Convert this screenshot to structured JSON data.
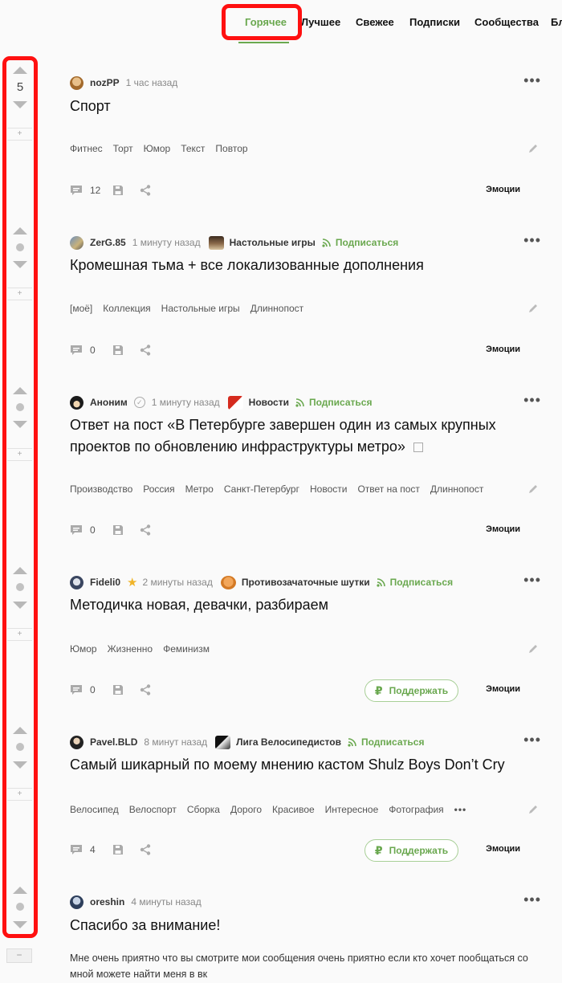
{
  "nav": {
    "tabs": [
      {
        "label": "Горячее",
        "active": true
      },
      {
        "label": "Лучшее",
        "active": false
      },
      {
        "label": "Свежее",
        "active": false
      },
      {
        "label": "Подписки",
        "active": false
      },
      {
        "label": "Сообщества",
        "active": false
      },
      {
        "label": "Бл",
        "active": false
      }
    ]
  },
  "colors": {
    "accent": "#6aa84f",
    "highlight": "#ff1010"
  },
  "rating": {
    "first_score": "5",
    "separator_glyph": "+",
    "collapse_glyph": "−"
  },
  "stories": [
    {
      "author": "nozPP",
      "time": "1 час назад",
      "title": "Спорт",
      "tags": [
        "Фитнес",
        "Торт",
        "Юмор",
        "Текст",
        "Повтор"
      ],
      "comments": "12",
      "emotions": "Эмоции"
    },
    {
      "author": "ZerG.85",
      "time": "1 минуту назад",
      "community": "Настольные игры",
      "subscribe": "Подписаться",
      "title": "Кромешная тьма + все локализованные дополнения",
      "tags": [
        "[моё]",
        "Коллекция",
        "Настольные игры",
        "Длиннопост"
      ],
      "comments": "0",
      "emotions": "Эмоции"
    },
    {
      "author": "Аноним",
      "time": "1 минуту назад",
      "community": "Новости",
      "subscribe": "Подписаться",
      "title_line1": "Ответ на пост «В Петербурге завершен один из самых крупных",
      "title_line2": "проектов по обновлению инфраструктуры метро»",
      "tags": [
        "Производство",
        "Россия",
        "Метро",
        "Санкт-Петербург",
        "Новости",
        "Ответ на пост",
        "Длиннопост"
      ],
      "comments": "0",
      "emotions": "Эмоции"
    },
    {
      "author": "Fideli0",
      "time": "2 минуты назад",
      "community": "Противозачаточные шутки",
      "subscribe": "Подписаться",
      "title": "Методичка новая, девачки, разбираем",
      "tags": [
        "Юмор",
        "Жизненно",
        "Феминизм"
      ],
      "comments": "0",
      "support": "Поддержать",
      "emotions": "Эмоции"
    },
    {
      "author": "Pavel.BLD",
      "time": "8 минут назад",
      "community": "Лига Велосипедистов",
      "subscribe": "Подписаться",
      "title": "Самый шикарный по моему мнению кастом Shulz Boys Don’t Cry",
      "tags": [
        "Велосипед",
        "Велоспорт",
        "Сборка",
        "Дорого",
        "Красивое",
        "Интересное",
        "Фотография"
      ],
      "tags_more": "•••",
      "comments": "4",
      "support": "Поддержать",
      "emotions": "Эмоции"
    },
    {
      "author": "oreshin",
      "time": "4 минуты назад",
      "title": "Спасибо за внимание!",
      "body_line1": "Мне очень приятно что вы смотрите мои сообщения очень приятно если кто хочет пообщаться со",
      "body_line2": "мной можете найти меня в вк"
    }
  ],
  "icons": {
    "comment": "comment-icon",
    "save": "save-icon",
    "share": "share-icon",
    "edit": "pencil-icon",
    "more": "more-dots-icon",
    "rss": "rss-icon",
    "ruble": "ruble-icon",
    "external": "external-link-icon"
  }
}
